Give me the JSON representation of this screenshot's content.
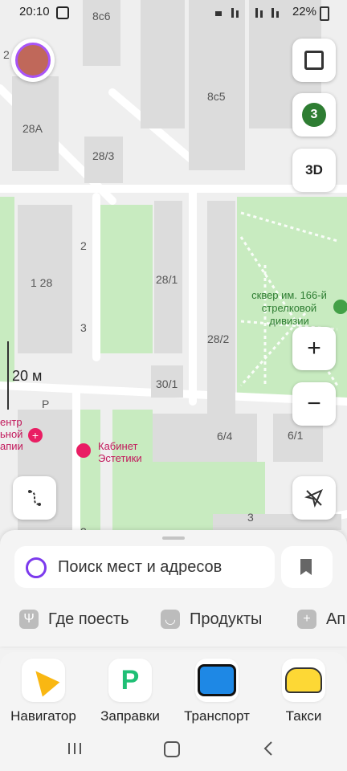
{
  "status_bar": {
    "time": "20:10",
    "battery": "22%"
  },
  "map": {
    "buildings": [
      "8с6",
      "8с5",
      "28А",
      "28/3",
      "2",
      "1 28",
      "3",
      "28/1",
      "28/2",
      "30/1",
      "6/4",
      "6/1",
      "2",
      "3",
      "2"
    ],
    "park_label": "сквер им. 166-й стрелковой дивизии",
    "poi_cut": "ентр\nьной\nапии",
    "poi_cabinet": "Кабинет\nЭстетики",
    "parking": "P",
    "scale": "20 м",
    "user_badge": "3",
    "btn_3d": "3D",
    "zoom_in": "+",
    "zoom_out": "−"
  },
  "sheet": {
    "search_placeholder": "Поиск мест и адресов",
    "chips": [
      {
        "label": "Где поесть",
        "icon": "fork-knife-icon"
      },
      {
        "label": "Продукты",
        "icon": "basket-icon"
      },
      {
        "label": "Ап",
        "icon": "plus-icon"
      }
    ]
  },
  "services": [
    {
      "label": "Навигатор",
      "icon": "navigator-arrow-icon"
    },
    {
      "label": "Заправки",
      "icon": "fuel-icon"
    },
    {
      "label": "Транспорт",
      "icon": "bus-icon"
    },
    {
      "label": "Такси",
      "icon": "taxi-icon"
    }
  ],
  "colors": {
    "park": "#c8ebc0",
    "building": "#dcdcdc",
    "road": "#ffffff",
    "accent": "#7c3aed"
  }
}
